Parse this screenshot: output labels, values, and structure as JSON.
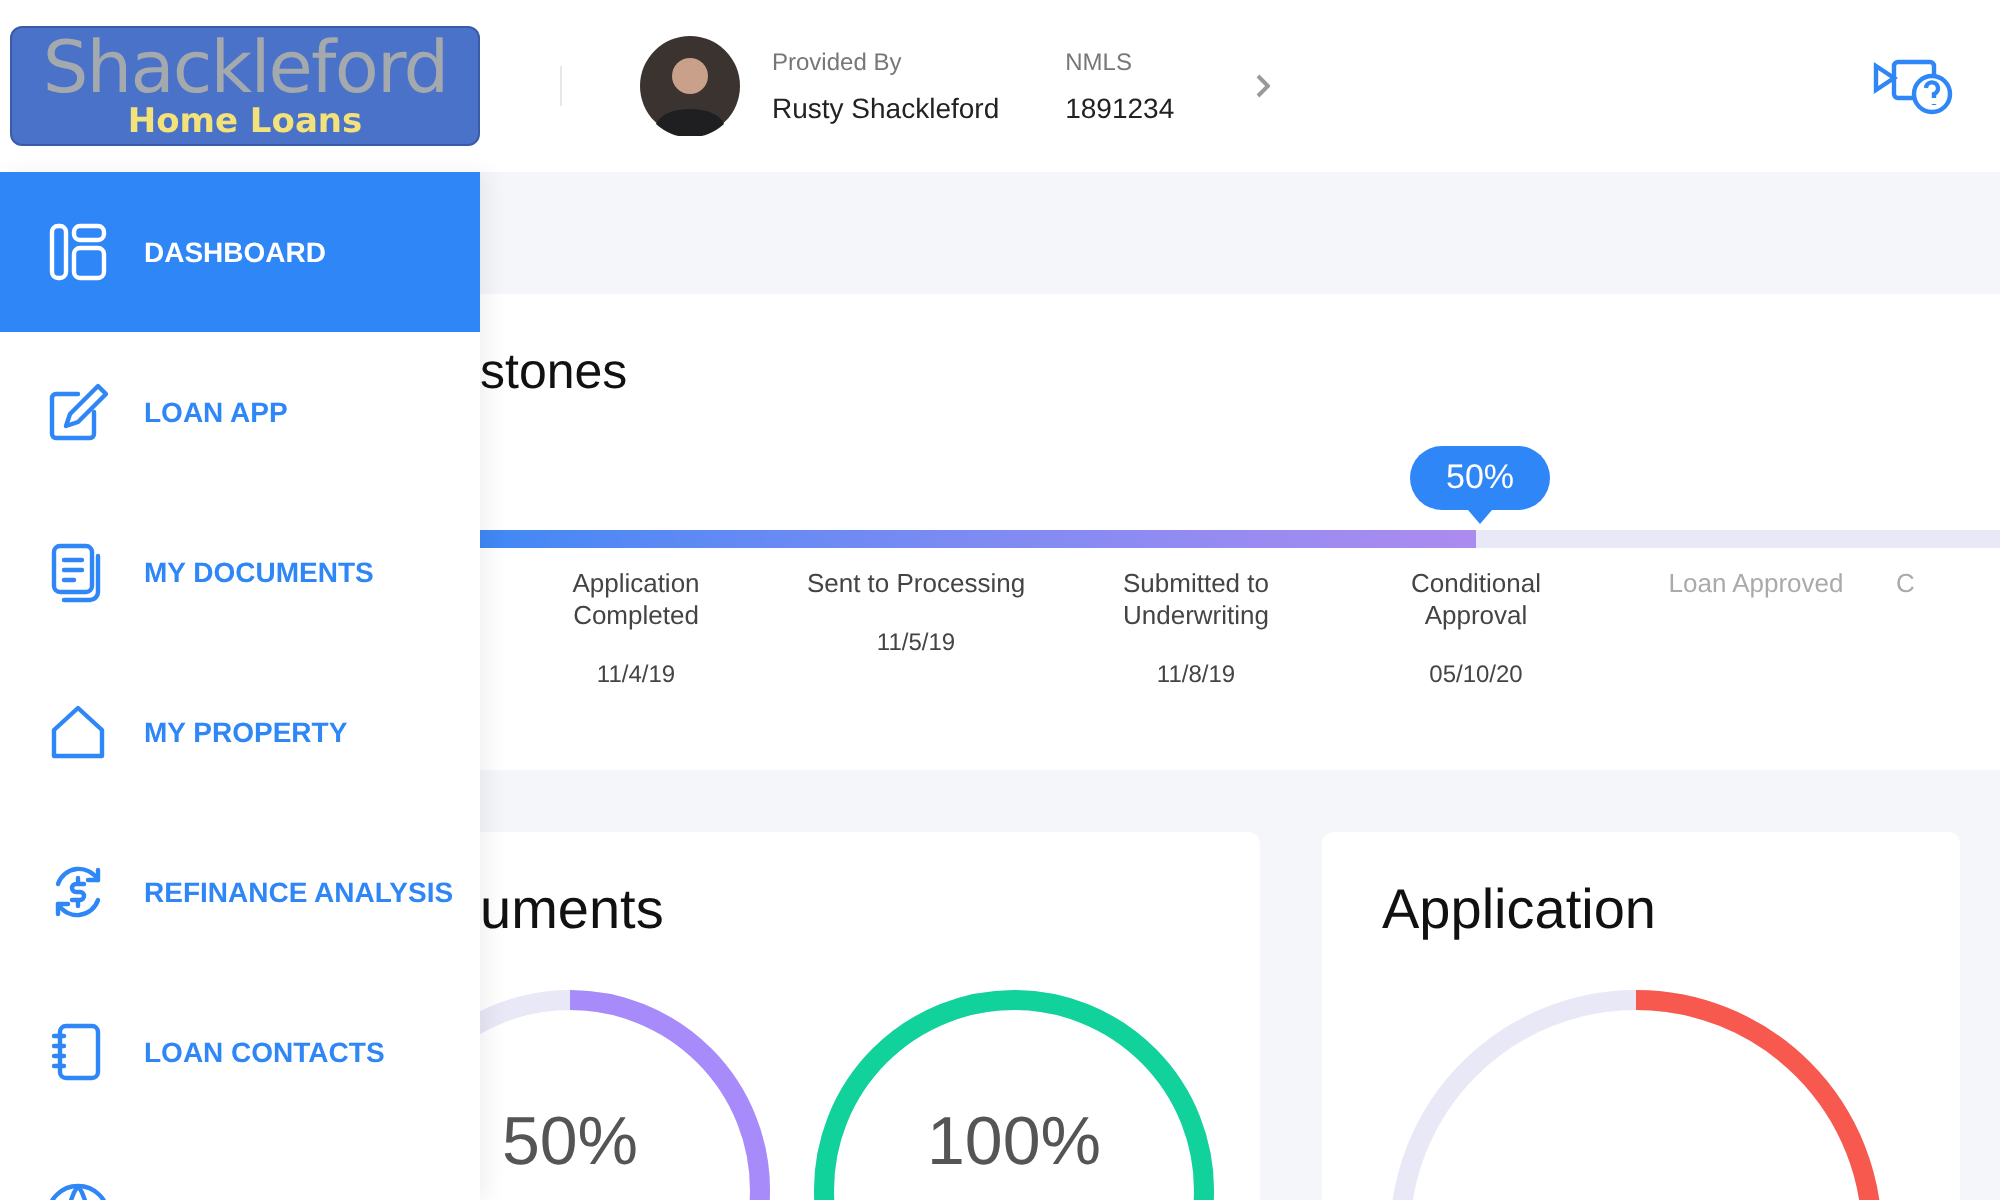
{
  "logo": {
    "line_1": "Shackleford",
    "line_2": "Home Loans"
  },
  "provider": {
    "label": "Provided By",
    "name": "Rusty Shackleford"
  },
  "nmls": {
    "label": "NMLS",
    "value": "1891234"
  },
  "sidebar": {
    "items": [
      {
        "label": "DASHBOARD",
        "kind": "dashboard",
        "selected": true
      },
      {
        "label": "LOAN APP",
        "kind": "edit",
        "selected": false
      },
      {
        "label": "MY DOCUMENTS",
        "kind": "documents",
        "selected": false
      },
      {
        "label": "MY PROPERTY",
        "kind": "home",
        "selected": false
      },
      {
        "label": "REFINANCE ANALYSIS",
        "kind": "refinance",
        "selected": false
      },
      {
        "label": "LOAN CONTACTS",
        "kind": "notebook",
        "selected": false
      }
    ]
  },
  "milestones": {
    "title": "stones",
    "progress_label": "50%",
    "level": 0.655,
    "steps": [
      {
        "label": "Application Completed",
        "date": "11/4/19",
        "completed": true
      },
      {
        "label": "Sent to Processing",
        "date": "11/5/19",
        "completed": true
      },
      {
        "label": "Submitted to Underwriting",
        "date": "11/8/19",
        "completed": true
      },
      {
        "label": "Conditional Approval",
        "date": "05/10/20",
        "completed": true
      },
      {
        "label": "Loan Approved",
        "completed": false
      },
      {
        "label": "C",
        "completed": false
      }
    ]
  },
  "documents": {
    "title": "uments",
    "rings": [
      {
        "reading": "50%",
        "kind": "partial",
        "color": "#a78bfa"
      },
      {
        "reading": "100%",
        "kind": "full",
        "color": "#10d29a"
      }
    ]
  },
  "application": {
    "title": "Application",
    "kind": "partial",
    "color": "#f8594f"
  }
}
